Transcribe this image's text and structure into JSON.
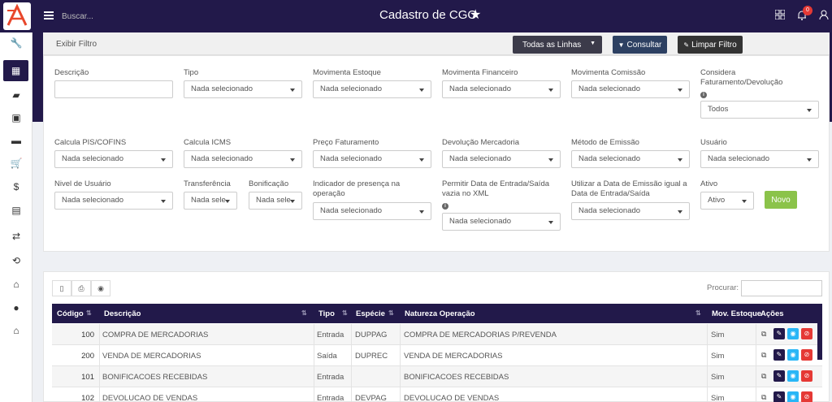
{
  "app": {
    "title": "Cadastro de CGO",
    "logo": "A"
  },
  "topbar": {
    "search_placeholder": "Buscar...",
    "notification_count": "0"
  },
  "filter_bar": {
    "label": "Exibir Filtro",
    "lines_select": "Todas as Linhas",
    "consultar": "Consultar",
    "limpar": "Limpar Filtro"
  },
  "filters": {
    "descricao": {
      "label": "Descrição",
      "value": ""
    },
    "tipo": {
      "label": "Tipo",
      "value": "Nada selecionado"
    },
    "mov_estoque": {
      "label": "Movimenta Estoque",
      "value": "Nada selecionado"
    },
    "mov_financeiro": {
      "label": "Movimenta Financeiro",
      "value": "Nada selecionado"
    },
    "mov_comissao": {
      "label": "Movimenta Comissão",
      "value": "Nada selecionado"
    },
    "considera": {
      "label": "Considera Faturamento/Devolução",
      "value": "Todos"
    },
    "pis": {
      "label": "Calcula PIS/COFINS",
      "value": "Nada selecionado"
    },
    "icms": {
      "label": "Calcula ICMS",
      "value": "Nada selecionado"
    },
    "preco": {
      "label": "Preço Faturamento",
      "value": "Nada selecionado"
    },
    "devolucao": {
      "label": "Devolução Mercadoria",
      "value": "Nada selecionado"
    },
    "metodo": {
      "label": "Método de Emissão",
      "value": "Nada selecionado"
    },
    "usuario": {
      "label": "Usuário",
      "value": "Nada selecionado"
    },
    "nivel": {
      "label": "Nivel de Usuário",
      "value": "Nada selecionado"
    },
    "transferencia": {
      "label": "Transferência",
      "value": "Nada sele"
    },
    "bonificacao": {
      "label": "Bonificação",
      "value": "Nada sele"
    },
    "indicador": {
      "label": "Indicador de presença na operação",
      "value": "Nada selecionado"
    },
    "permitir": {
      "label": "Permitir Data de Entrada/Saída vazia no XML",
      "value": "Nada selecionado"
    },
    "utilizar": {
      "label": "Utilizar a Data de Emissão igual a Data de Entrada/Saída",
      "value": "Nada selecionado"
    },
    "ativo": {
      "label": "Ativo",
      "value": "Ativo"
    },
    "novo": "Novo"
  },
  "table": {
    "search_label": "Procurar:",
    "headers": {
      "codigo": "Código",
      "descricao": "Descrição",
      "tipo": "Tipo",
      "especie": "Espécie",
      "natureza": "Natureza Operação",
      "mov": "Mov. Estoque",
      "acoes": "Ações"
    },
    "rows": [
      {
        "codigo": "100",
        "descricao": "COMPRA DE MERCADORIAS",
        "tipo": "Entrada",
        "especie": "DUPPAG",
        "natureza": "COMPRA DE MERCADORIAS P/REVENDA",
        "mov": "Sim"
      },
      {
        "codigo": "200",
        "descricao": "VENDA DE MERCADORIAS",
        "tipo": "Saída",
        "especie": "DUPREC",
        "natureza": "VENDA DE MERCADORIAS",
        "mov": "Sim"
      },
      {
        "codigo": "101",
        "descricao": "BONIFICACOES RECEBIDAS",
        "tipo": "Entrada",
        "especie": "",
        "natureza": "BONIFICACOES RECEBIDAS",
        "mov": "Sim"
      },
      {
        "codigo": "102",
        "descricao": "DEVOLUCAO DE VENDAS",
        "tipo": "Entrada",
        "especie": "DEVPAG",
        "natureza": "DEVOLUCAO DE VENDAS",
        "mov": "Sim"
      }
    ]
  },
  "colors": {
    "brand": "#22194a",
    "accent": "#e53935",
    "green": "#8bc34a",
    "blue": "#29b6f6"
  }
}
